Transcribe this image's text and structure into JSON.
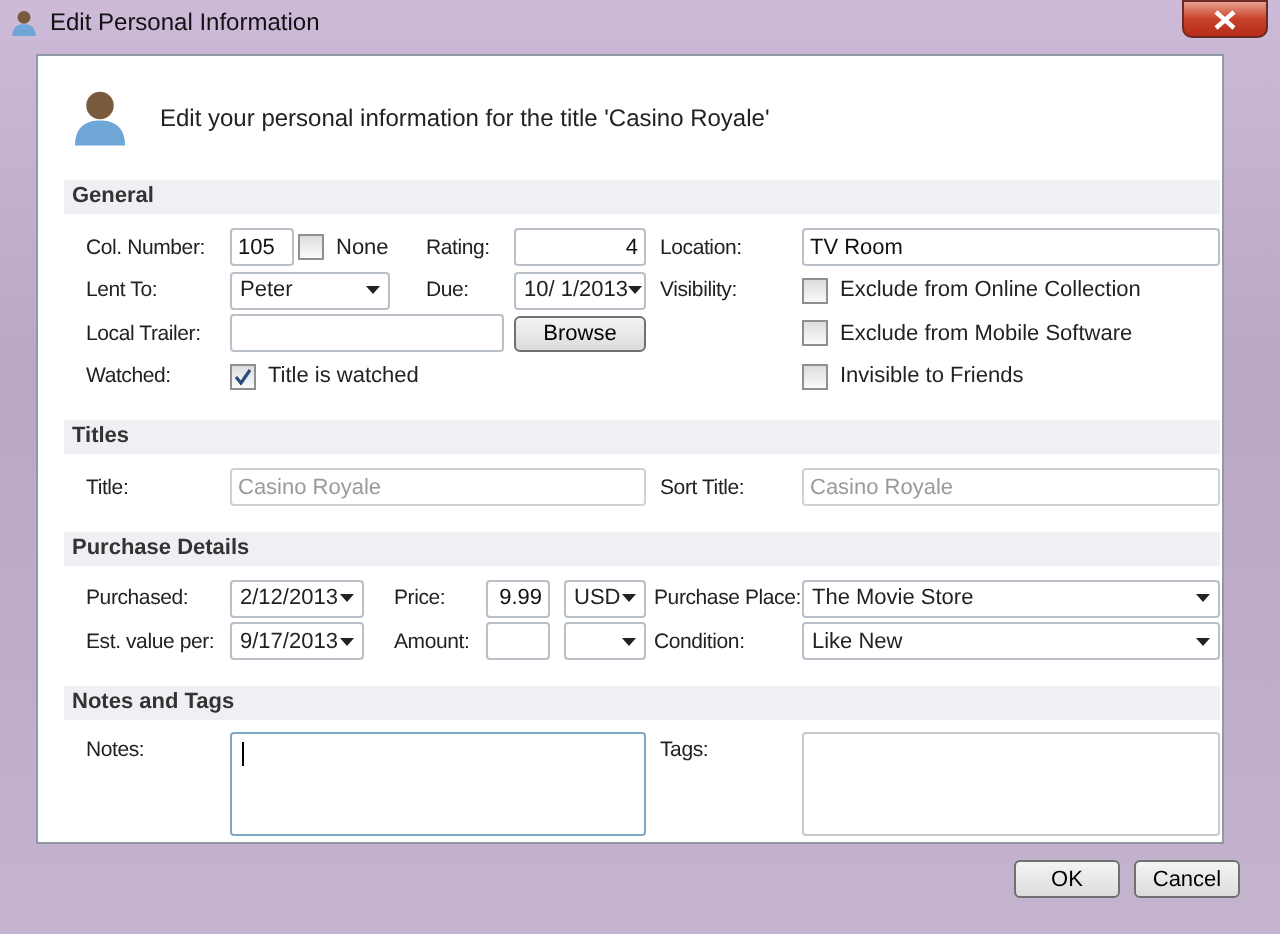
{
  "window": {
    "title": "Edit Personal Information"
  },
  "header": {
    "text": "Edit your personal information for the title 'Casino Royale'"
  },
  "sections": [
    {
      "title": "General",
      "rows": [
        {
          "items": [
            {
              "kind": "label",
              "text": "Col. Number:"
            },
            {
              "kind": "text",
              "value": "105",
              "disabled": false
            },
            {
              "kind": "check",
              "label": "None",
              "checked": false
            },
            {
              "kind": "label",
              "text": "Rating:"
            },
            {
              "kind": "number",
              "value": "4",
              "disabled": false
            },
            {
              "kind": "label",
              "text": "Location:"
            },
            {
              "kind": "text",
              "value": "TV Room",
              "disabled": false
            }
          ]
        },
        {
          "items": [
            {
              "kind": "label",
              "text": "Lent To:"
            },
            {
              "kind": "combo",
              "value": "Peter"
            },
            {
              "kind": "label",
              "text": "Due:"
            },
            {
              "kind": "combo",
              "value": "10/ 1/2013"
            },
            {
              "kind": "label",
              "text": "Visibility:"
            },
            {
              "kind": "check",
              "label": "Exclude from Online Collection",
              "checked": false
            }
          ]
        },
        {
          "items": [
            {
              "kind": "label",
              "text": "Local Trailer:"
            },
            {
              "kind": "text",
              "disabled": false
            },
            {
              "kind": "button",
              "label": "Browse"
            },
            {
              "kind": "check",
              "label": "Exclude from Mobile Software",
              "checked": false
            }
          ]
        },
        {
          "items": [
            {
              "kind": "label",
              "text": "Watched:"
            },
            {
              "kind": "check",
              "label": "Title is watched",
              "checked": true
            },
            {
              "kind": "check",
              "label": "Invisible to Friends",
              "checked": false
            }
          ]
        }
      ]
    },
    {
      "title": "Titles",
      "rows": [
        {
          "items": [
            {
              "kind": "label",
              "text": "Title:"
            },
            {
              "kind": "text",
              "value": "Casino Royale",
              "disabled": true
            },
            {
              "kind": "label",
              "text": "Sort Title:"
            },
            {
              "kind": "text",
              "value": "Casino Royale",
              "disabled": true
            }
          ]
        }
      ]
    },
    {
      "title": "Purchase Details",
      "rows": [
        {
          "items": [
            {
              "kind": "label",
              "text": "Purchased:"
            },
            {
              "kind": "combo",
              "value": "2/12/2013"
            },
            {
              "kind": "label",
              "text": "Price:"
            },
            {
              "kind": "number",
              "value": "9.99",
              "disabled": false
            },
            {
              "kind": "combo",
              "value": "USD"
            },
            {
              "kind": "label",
              "text": "Purchase Place:"
            },
            {
              "kind": "combo",
              "value": "The Movie Store"
            }
          ]
        },
        {
          "items": [
            {
              "kind": "label",
              "text": "Est. value per:"
            },
            {
              "kind": "combo",
              "value": "9/17/2013"
            },
            {
              "kind": "label",
              "text": "Amount:"
            },
            {
              "kind": "number",
              "disabled": false
            },
            {
              "kind": "combo"
            },
            {
              "kind": "label",
              "text": "Condition:"
            },
            {
              "kind": "combo",
              "value": "Like New"
            }
          ]
        }
      ]
    },
    {
      "title": "Notes and Tags",
      "rows": [
        {
          "items": [
            {
              "kind": "label",
              "text": "Notes:"
            },
            {
              "kind": "memo",
              "focused": true
            },
            {
              "kind": "label",
              "text": "Tags:"
            },
            {
              "kind": "memo",
              "focused": false
            }
          ]
        }
      ]
    }
  ],
  "buttons": [
    "OK",
    "Cancel"
  ]
}
